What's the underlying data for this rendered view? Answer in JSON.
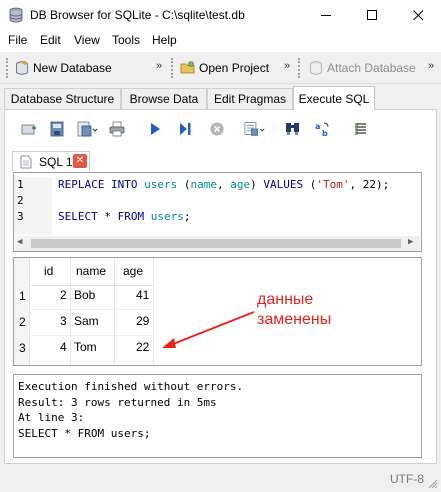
{
  "window": {
    "title": "DB Browser for SQLite - C:\\sqlite\\test.db",
    "minimize_glyph": "—",
    "maximize_glyph": "☐",
    "close_glyph": "✕"
  },
  "menu": [
    "File",
    "Edit",
    "View",
    "Tools",
    "Help"
  ],
  "toolbar": {
    "new_database": "New Database",
    "open_project": "Open Project",
    "attach_database": "Attach Database",
    "overflow": "»"
  },
  "tabs": [
    "Database Structure",
    "Browse Data",
    "Edit Pragmas",
    "Execute SQL"
  ],
  "active_tab": "Execute SQL",
  "sql_tab": {
    "label": "SQL 1",
    "close": "✕"
  },
  "editor": {
    "lines": [
      {
        "num": "1",
        "text": "REPLACE INTO users (name, age) VALUES ('Tom', 22);"
      },
      {
        "num": "2",
        "text": ""
      },
      {
        "num": "3",
        "text": "SELECT * FROM users;"
      }
    ]
  },
  "results": {
    "columns": [
      "id",
      "name",
      "age"
    ],
    "rows": [
      {
        "rownum": "1",
        "id": "2",
        "name": "Bob",
        "age": "41"
      },
      {
        "rownum": "2",
        "id": "3",
        "name": "Sam",
        "age": "29"
      },
      {
        "rownum": "3",
        "id": "4",
        "name": "Tom",
        "age": "22"
      }
    ]
  },
  "annotation": {
    "line1": "данные",
    "line2": "заменены",
    "color": "#e8221e"
  },
  "output": {
    "lines": [
      "Execution finished without errors.",
      "Result: 3 rows returned in 5ms",
      "At line 3:",
      "SELECT * FROM users;"
    ]
  },
  "status": {
    "encoding": "UTF-8"
  },
  "colors": {
    "keyword": "#00008b",
    "identifier": "#008b8b",
    "string": "#b22222",
    "play": "#1e5fbf"
  }
}
